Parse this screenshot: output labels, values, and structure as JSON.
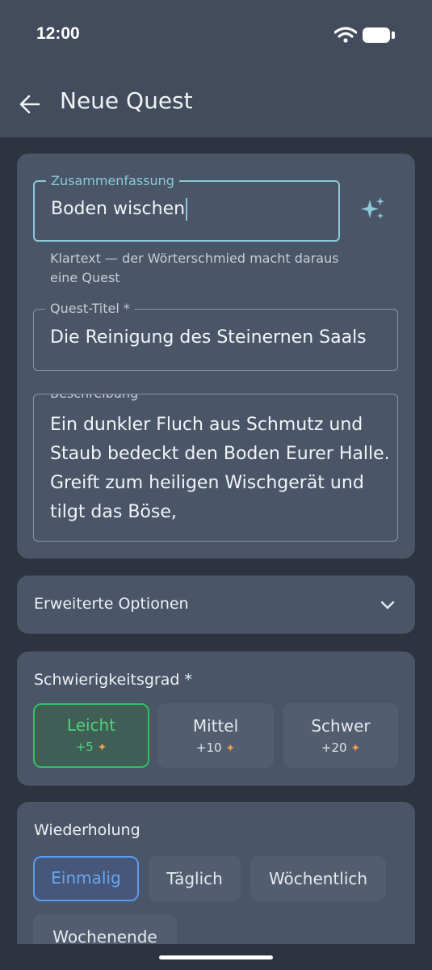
{
  "status": {
    "time": "12:00"
  },
  "appbar": {
    "title": "Neue Quest"
  },
  "summary": {
    "label": "Zusammenfassung",
    "value": "Boden wischen",
    "helper": "Klartext — der Wörterschmied macht daraus eine Quest"
  },
  "quest_title": {
    "label": "Quest-Titel *",
    "value": "Die Reinigung des Steinernen Saals"
  },
  "description": {
    "label": "Beschreibung",
    "value": "Ein dunkler Fluch aus Schmutz und Staub bedeckt den Boden Eurer Halle. Greift zum heiligen Wischgerät und tilgt das Böse,"
  },
  "advanced": {
    "label": "Erweiterte Optionen"
  },
  "difficulty": {
    "title": "Schwierigkeitsgrad *",
    "options": [
      {
        "label": "Leicht",
        "xp": "+5",
        "selected": true
      },
      {
        "label": "Mittel",
        "xp": "+10",
        "selected": false
      },
      {
        "label": "Schwer",
        "xp": "+20",
        "selected": false
      }
    ],
    "xp_icon": "star-person-icon"
  },
  "repetition": {
    "title": "Wiederholung",
    "options": [
      {
        "label": "Einmalig",
        "selected": true
      },
      {
        "label": "Täglich",
        "selected": false
      },
      {
        "label": "Wöchentlich",
        "selected": false
      },
      {
        "label": "Wochenende",
        "selected": false
      }
    ]
  },
  "colors": {
    "accent_focus": "#8cc8d6",
    "selected_green": "#30c062",
    "selected_blue": "#5b9bf0",
    "xp_star": "#f0a044"
  }
}
